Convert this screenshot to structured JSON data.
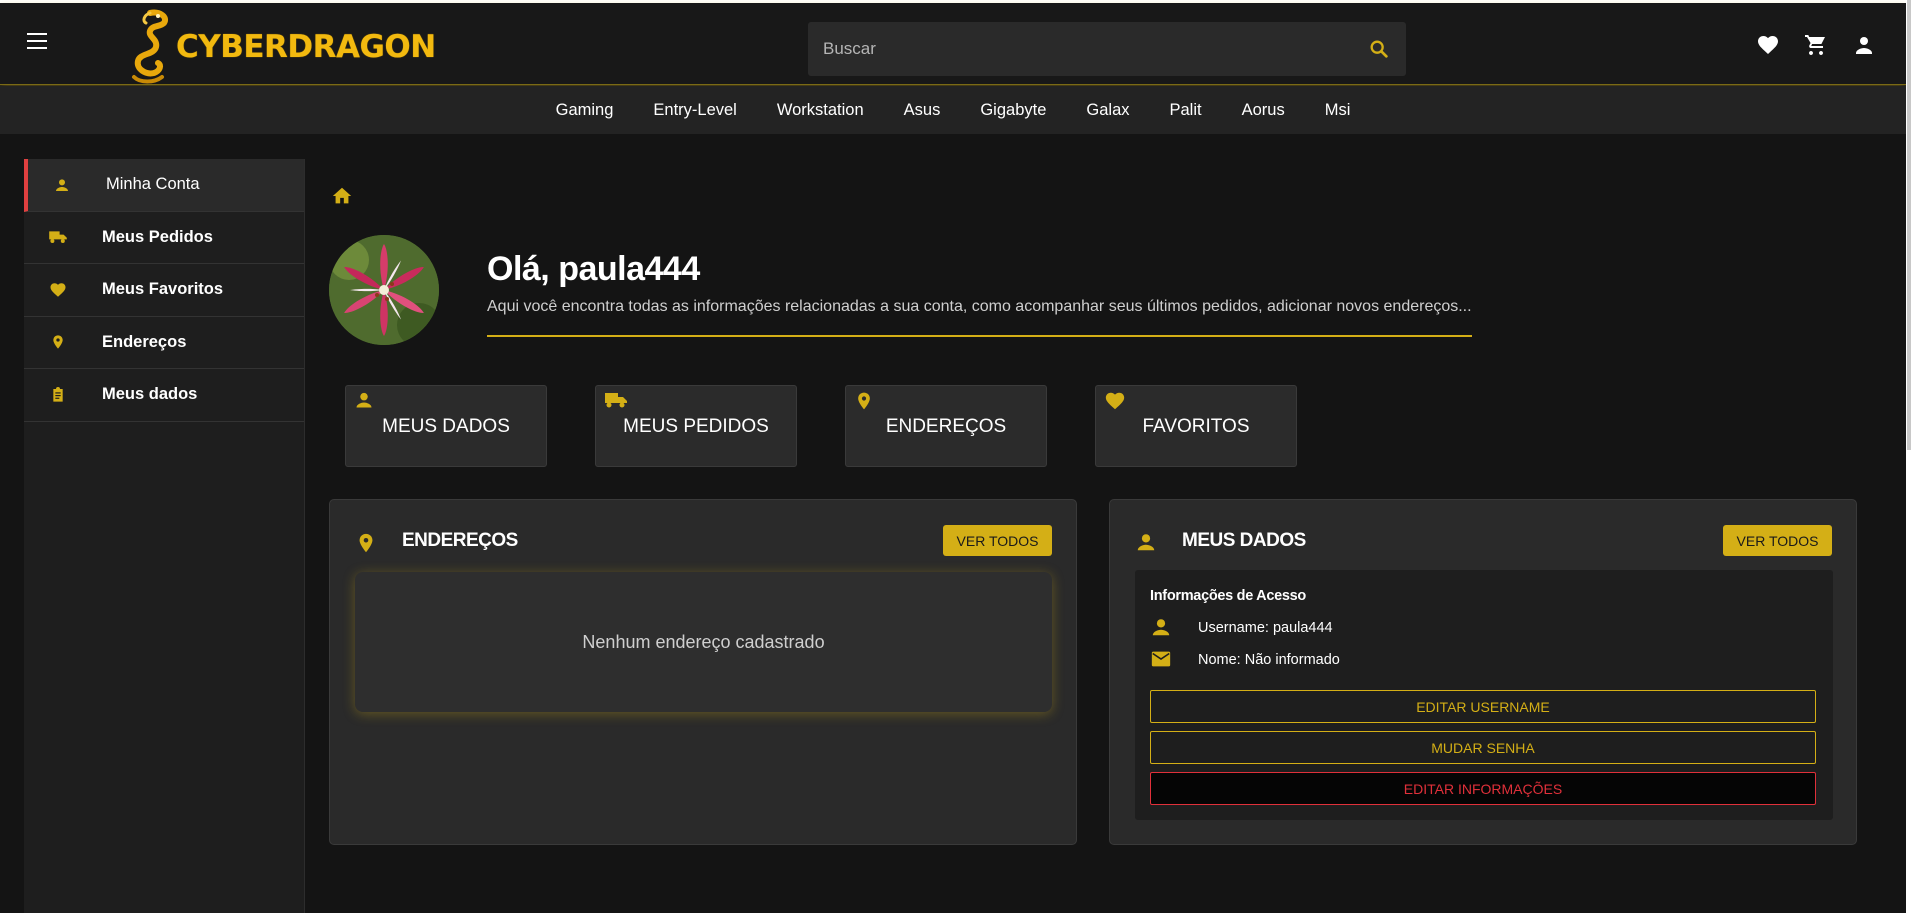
{
  "header": {
    "logo_text": "CYBERDRAGON",
    "search_placeholder": "Buscar"
  },
  "nav": {
    "items": [
      "Gaming",
      "Entry-Level",
      "Workstation",
      "Asus",
      "Gigabyte",
      "Galax",
      "Palit",
      "Aorus",
      "Msi"
    ]
  },
  "sidebar": {
    "items": [
      {
        "label": "Minha Conta",
        "icon": "person-icon"
      },
      {
        "label": "Meus Pedidos",
        "icon": "truck-icon"
      },
      {
        "label": "Meus Favoritos",
        "icon": "heart-icon"
      },
      {
        "label": "Endereços",
        "icon": "location-pin-icon"
      },
      {
        "label": "Meus dados",
        "icon": "clipboard-icon"
      }
    ]
  },
  "profile": {
    "greeting": "Olá, paula444",
    "subtitle": "Aqui você encontra todas as informações relacionadas a sua conta, como acompanhar seus últimos pedidos, adicionar novos endereços..."
  },
  "quick_cards": [
    {
      "label": "MEUS DADOS",
      "icon": "person-icon"
    },
    {
      "label": "MEUS PEDIDOS",
      "icon": "truck-icon"
    },
    {
      "label": "ENDEREÇOS",
      "icon": "location-pin-icon"
    },
    {
      "label": "FAVORITOS",
      "icon": "heart-icon"
    }
  ],
  "addresses_panel": {
    "title": "ENDEREÇOS",
    "view_all": "VER TODOS",
    "empty_text": "Nenhum endereço cadastrado"
  },
  "data_panel": {
    "title": "MEUS DADOS",
    "view_all": "VER TODOS",
    "access_title": "Informações de Acesso",
    "username": "Username: paula444",
    "name": "Nome: Não informado",
    "edit_username": "EDITAR USERNAME",
    "change_password": "MUDAR SENHA",
    "edit_info": "EDITAR INFORMAÇÕES"
  },
  "colors": {
    "accent": "#d4af16",
    "danger": "#e0303a",
    "background": "#141414"
  }
}
